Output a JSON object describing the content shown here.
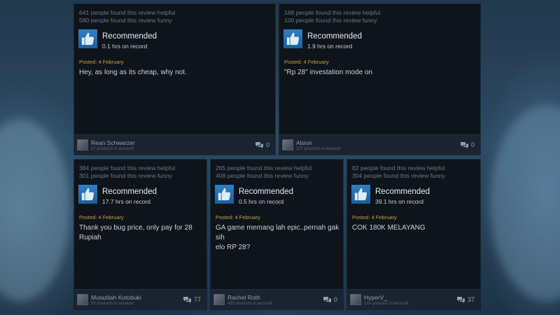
{
  "reviews": [
    {
      "helpful": "641 people found this review helpful",
      "funny": "580 people found this review funny",
      "recommendation": "Recommended",
      "hours": "0.1 hrs on record",
      "posted": "Posted: 4 February",
      "text": "Hey, as long as its cheap, why not.",
      "author": "Rean Schwarzer",
      "products": "67 products in account",
      "comments": "0",
      "icon": "thumbs-up-icon"
    },
    {
      "helpful": "168 people found this review helpful",
      "funny": "100 people found this review funny",
      "recommendation": "Recommended",
      "hours": "1.9 hrs on record",
      "posted": "Posted: 4 February",
      "text": "\"Rp 28\" investation mode on",
      "author": "Alsion",
      "products": "227 products in account",
      "comments": "0",
      "icon": "thumbs-up-icon"
    },
    {
      "helpful": "384 people found this review helpful",
      "funny": "301 people found this review funny",
      "recommendation": "Recommended",
      "hours": "17.7 hrs on record",
      "posted": "Posted: 4 February",
      "text_lines": [
        "Thank you bug price, only pay for 28",
        "Rupiah"
      ],
      "author": "Mutazilah Kotobuki",
      "products": "55 products in account",
      "comments": "77",
      "icon": "thumbs-up-icon"
    },
    {
      "helpful": "265 people found this review helpful",
      "funny": "408 people found this review funny",
      "recommendation": "Recommended",
      "hours": "0.5 hrs on record",
      "posted": "Posted: 4 February",
      "text_lines": [
        "GA game memang lah epic..pernah gak sih",
        "elo RP 28?"
      ],
      "author": "Rachel Roth",
      "products": "493 products in account",
      "comments": "0",
      "icon": "thumbs-up-icon"
    },
    {
      "helpful": "82 people found this review helpful",
      "funny": "304 people found this review funny",
      "recommendation": "Recommended",
      "hours": "39.1 hrs on record",
      "posted": "Posted: 4 February",
      "text": "COK 180K MELAYANG",
      "author": "HyperV_",
      "products": "214 products in account",
      "comments": "37",
      "icon": "thumbs-up-icon"
    }
  ],
  "colors": {
    "card_bg": "#0f141b",
    "footer_bg": "#1a2431",
    "accent_icon": "#2f80c6",
    "posted_gold": "#c1a04a"
  }
}
